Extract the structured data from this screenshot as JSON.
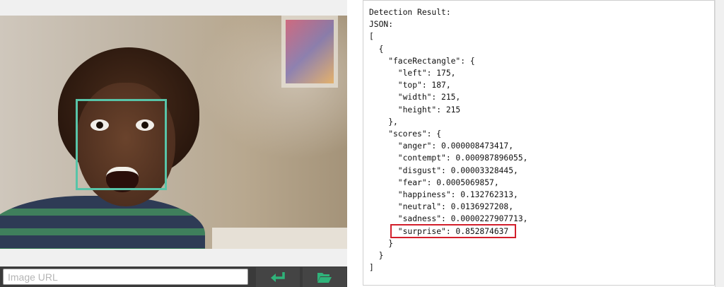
{
  "url_input": {
    "placeholder": "Image URL",
    "value": ""
  },
  "buttons": {
    "submit_icon": "enter-arrow-icon",
    "browse_icon": "folder-open-icon"
  },
  "colors": {
    "face_rectangle": "#58c4a8",
    "highlight": "#d21f2b",
    "button_icon": "#2fb37a"
  },
  "result": {
    "lines": [
      "Detection Result:",
      "JSON:",
      "[",
      "  {",
      "    \"faceRectangle\": {",
      "      \"left\": 175,",
      "      \"top\": 187,",
      "      \"width\": 215,",
      "      \"height\": 215",
      "    },",
      "    \"scores\": {",
      "      \"anger\": 0.000008473417,",
      "      \"contempt\": 0.000987896055,",
      "      \"disgust\": 0.00003328445,",
      "      \"fear\": 0.0005069857,",
      "      \"happiness\": 0.132762313,",
      "      \"neutral\": 0.0136927208,",
      "      \"sadness\": 0.0000227907713,",
      "      \"surprise\": 0.852874637",
      "    }",
      "  }",
      "]"
    ]
  }
}
